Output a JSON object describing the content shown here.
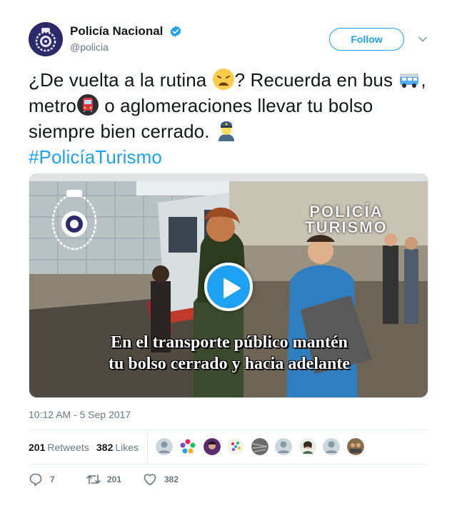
{
  "author": {
    "name": "Policía Nacional",
    "handle": "@policia",
    "verified": true
  },
  "follow_label": "Follow",
  "tweet": {
    "seg1": "¿De vuelta a la rutina ",
    "seg2": "? Recuerda en bus ",
    "seg3": ", metro",
    "seg4": " o aglomeraciones llevar tu bolso siempre bien cerrado. ",
    "hashtag": "#PolicíaTurismo",
    "emojis": [
      "weary-face-emoji",
      "bus-emoji",
      "metro-emoji",
      "police-officer-emoji"
    ]
  },
  "media": {
    "brand_line1": "POLICÍA",
    "brand_line2": "TURISMO",
    "caption_line1": "En el transporte público mantén",
    "caption_line2": "tu bolso cerrado y hacia adelante",
    "play_icon": "play-icon"
  },
  "timestamp": "10:12 AM - 5 Sep 2017",
  "stats": {
    "retweets_count": "201",
    "retweets_label": "Retweets",
    "likes_count": "382",
    "likes_label": "Likes"
  },
  "actions": {
    "reply_count": "7",
    "retweet_count": "201",
    "like_count": "382"
  },
  "colors": {
    "accent": "#1da1f2",
    "text": "#14171a",
    "muted": "#657786",
    "border": "#e6ecf0"
  }
}
